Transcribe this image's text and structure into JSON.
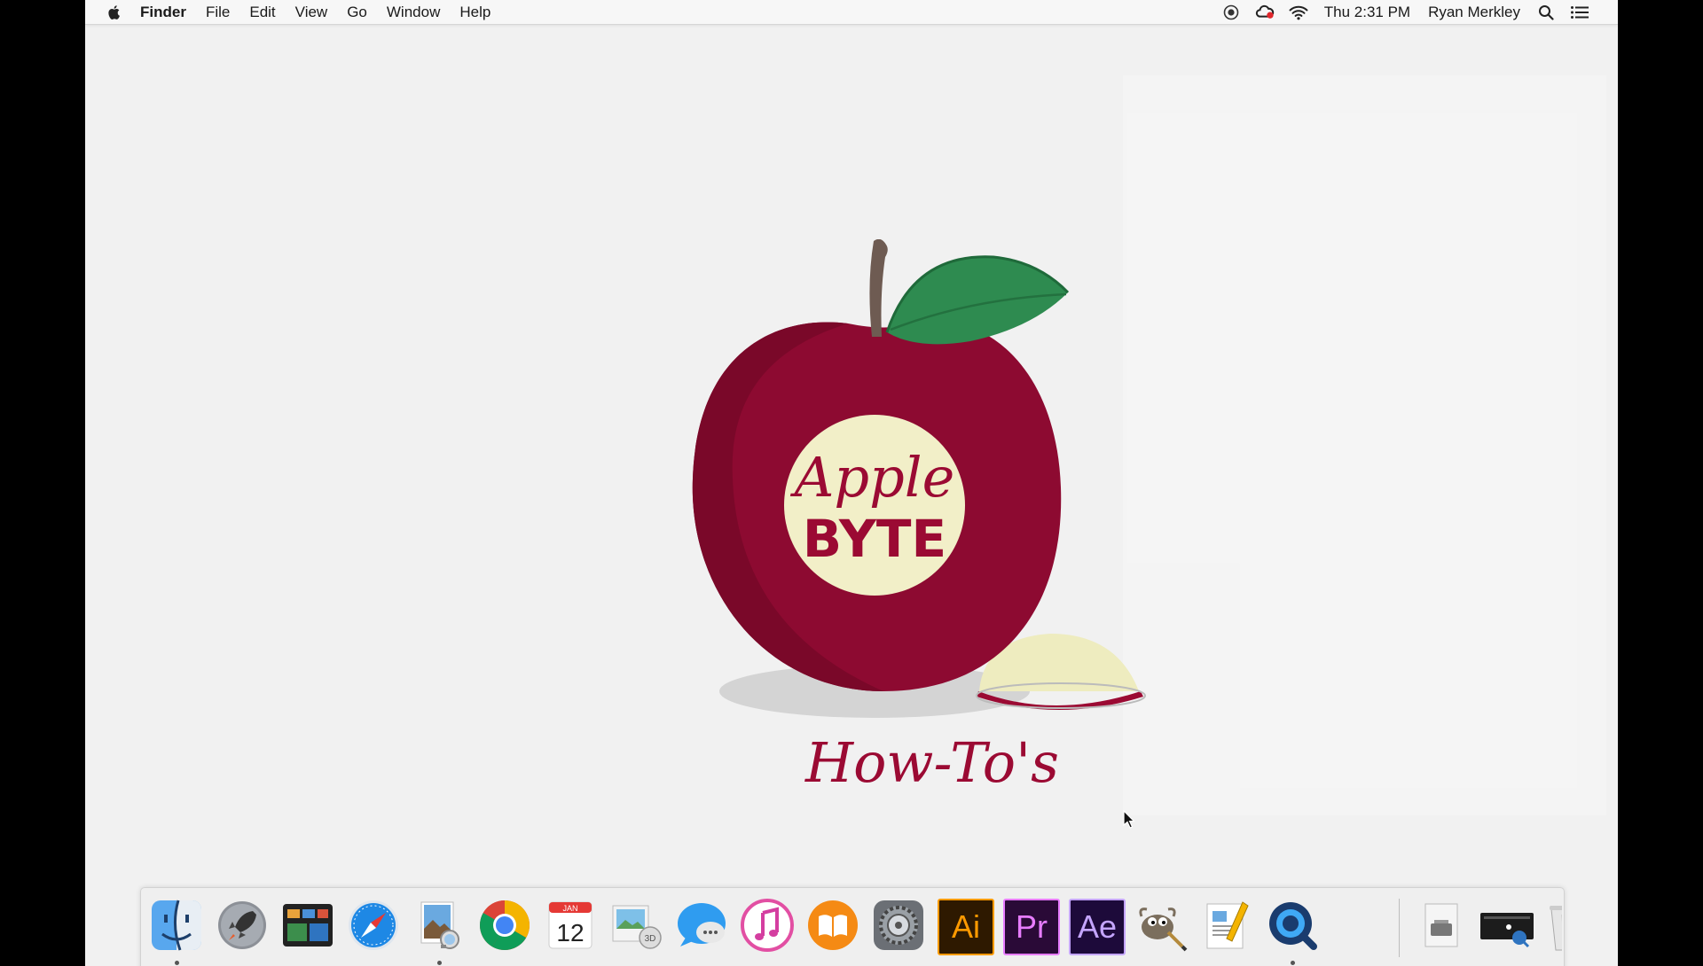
{
  "menubar": {
    "app_name": "Finder",
    "menus": [
      "File",
      "Edit",
      "View",
      "Go",
      "Window",
      "Help"
    ],
    "clock": "Thu 2:31 PM",
    "user": "Ryan Merkley"
  },
  "wallpaper_logo": {
    "line1": "Apple",
    "line2": "BYTE",
    "tagline": "How-To's",
    "colors": {
      "apple": "#9b0a33",
      "leaf": "#2e8b50",
      "badge": "#f2efc8"
    }
  },
  "dock": {
    "items": [
      {
        "name": "finder-dock-icon",
        "running": true
      },
      {
        "name": "launchpad-dock-icon",
        "running": false
      },
      {
        "name": "mission-control-dock-icon",
        "running": false
      },
      {
        "name": "safari-dock-icon",
        "running": false
      },
      {
        "name": "preview-dock-icon",
        "running": true
      },
      {
        "name": "chrome-dock-icon",
        "running": false
      },
      {
        "name": "calendar-dock-icon",
        "running": false
      },
      {
        "name": "photo-booth-dock-icon",
        "running": false
      },
      {
        "name": "messages-dock-icon",
        "running": false
      },
      {
        "name": "itunes-dock-icon",
        "running": false
      },
      {
        "name": "ibooks-dock-icon",
        "running": false
      },
      {
        "name": "system-preferences-dock-icon",
        "running": false
      },
      {
        "name": "illustrator-dock-icon",
        "running": false
      },
      {
        "name": "premiere-dock-icon",
        "running": false
      },
      {
        "name": "after-effects-dock-icon",
        "running": false
      },
      {
        "name": "gimp-dock-icon",
        "running": false
      },
      {
        "name": "textedit-dock-icon",
        "running": false
      },
      {
        "name": "quicktime-dock-icon",
        "running": true
      },
      {
        "name": "downloads-stack-dock-icon",
        "running": false
      },
      {
        "name": "screen-recordings-stack-dock-icon",
        "running": false
      },
      {
        "name": "trash-dock-icon",
        "running": false
      }
    ],
    "calendar_month": "JAN",
    "calendar_day": "12",
    "illustrator_label": "Ai",
    "premiere_label": "Pr",
    "after_effects_label": "Ae"
  }
}
